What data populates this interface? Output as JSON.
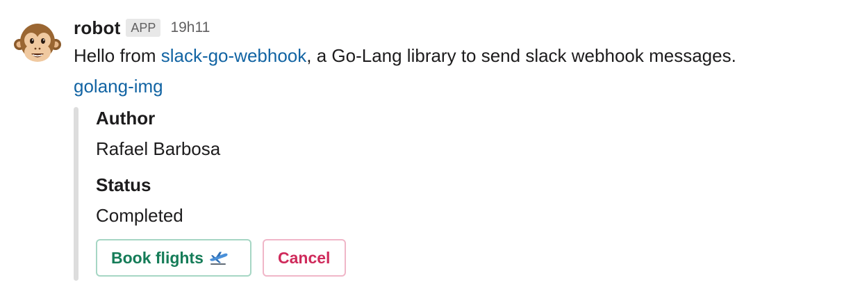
{
  "message": {
    "username": "robot",
    "badge": "APP",
    "timestamp": "19h11",
    "text_before_link": "Hello from ",
    "link_text": "slack-go-webhook",
    "text_after_link": ", a Go-Lang library to send slack webhook messages.",
    "image_link_text": "golang-img"
  },
  "attachment": {
    "bar_color": "#dddddd",
    "fields": [
      {
        "title": "Author",
        "value": "Rafael Barbosa"
      },
      {
        "title": "Status",
        "value": "Completed"
      }
    ],
    "actions": [
      {
        "label": "Book flights",
        "icon": "airplane-departure-icon",
        "style": "primary",
        "color": "#157c58"
      },
      {
        "label": "Cancel",
        "style": "danger",
        "color": "#cf2a5b"
      }
    ]
  },
  "avatar": {
    "icon": "monkey-face-icon"
  },
  "colors": {
    "link": "#1264a3",
    "text": "#1d1c1d",
    "muted": "#616061"
  }
}
